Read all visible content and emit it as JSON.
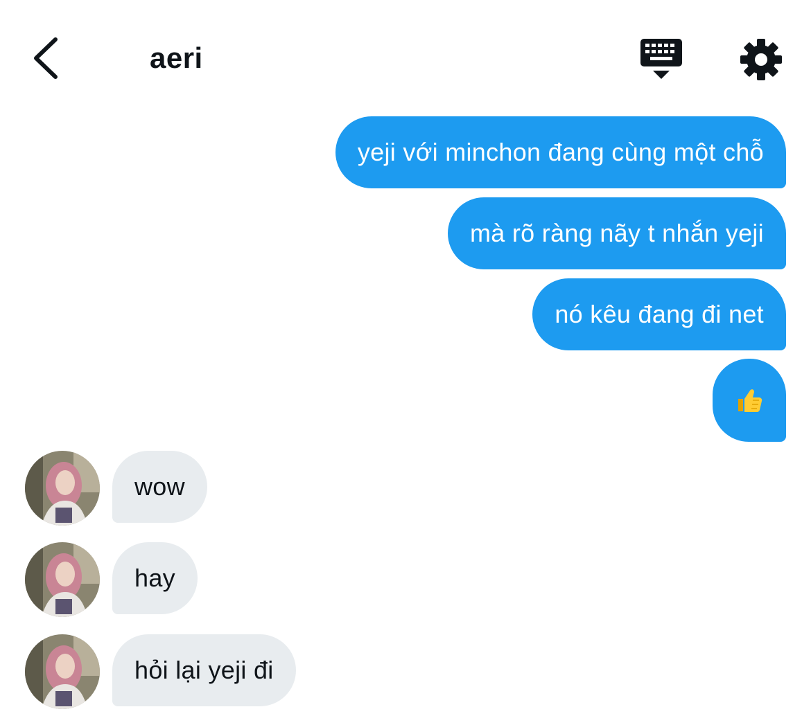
{
  "header": {
    "title": "aeri",
    "back_icon": "chevron-left-icon",
    "keyboard_icon": "keyboard-icon",
    "settings_icon": "gear-icon"
  },
  "colors": {
    "outgoing_bubble": "#1d9bf0",
    "incoming_bubble": "#e8ecef",
    "text_primary": "#0f1419"
  },
  "messages_out": [
    {
      "text": "yeji với minchon đang cùng một chỗ"
    },
    {
      "text": "mà rõ ràng nãy t nhắn yeji"
    },
    {
      "text": "nó kêu đang đi net"
    },
    {
      "text": "👍"
    }
  ],
  "messages_in": [
    {
      "text": "wow"
    },
    {
      "text": "hay"
    },
    {
      "text": "hỏi lại yeji đi"
    }
  ]
}
